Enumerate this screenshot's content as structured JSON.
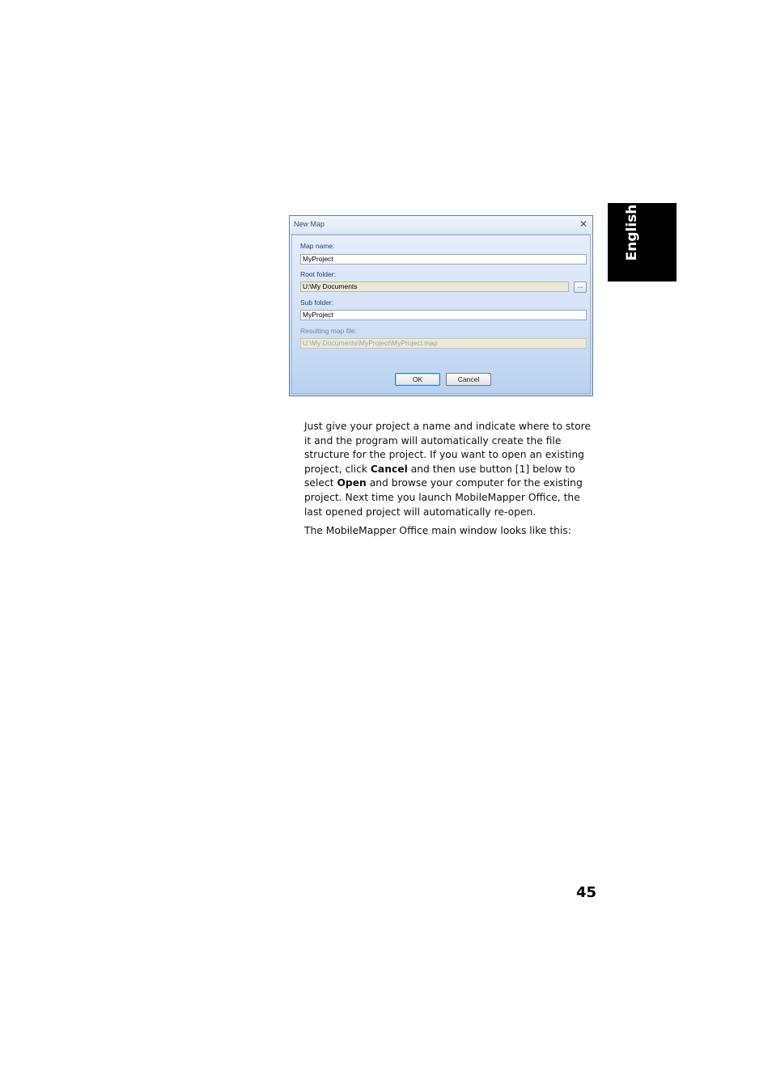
{
  "side_tab": {
    "label": "English"
  },
  "dialog": {
    "title": "New Map",
    "close_icon": "close-icon",
    "map_name": {
      "label": "Map name:",
      "value": "MyProject"
    },
    "root_folder": {
      "label": "Root folder:",
      "value": "U:\\My Documents",
      "browse_label": "..."
    },
    "sub_folder": {
      "label": "Sub folder:",
      "value": "MyProject"
    },
    "resulting_map_file": {
      "label": "Resulting map file:",
      "value": "U:\\My Documents\\MyProject\\MyProject.map"
    },
    "ok_label": "OK",
    "cancel_label": "Cancel"
  },
  "body": {
    "p1_a": "Just give your project a name and indicate where to store it and the program will automatically create the file structure for the project. If you want to open an existing project, click ",
    "p1_cancel": "Cancel",
    "p1_b": " and then use button [1] below to select ",
    "p1_open": "Open",
    "p1_c": " and browse your computer for the existing project. Next time you launch MobileMapper Office, the last opened project will automatically re-open.",
    "p2": "The MobileMapper Office main window looks like this:"
  },
  "page_number": "45"
}
